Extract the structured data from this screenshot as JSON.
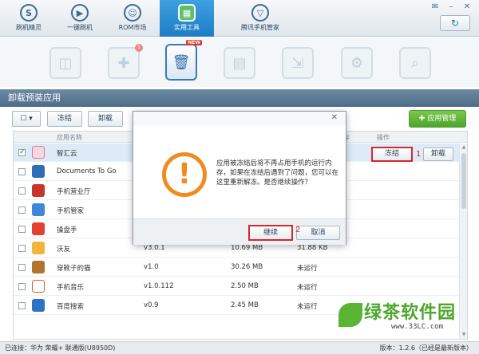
{
  "nav": {
    "items": [
      {
        "label": "刷机精灵",
        "icon": "S"
      },
      {
        "label": "一键刷机",
        "icon": "▶"
      },
      {
        "label": "ROM市场",
        "icon": "☺"
      },
      {
        "label": "实用工具",
        "icon": "▦"
      },
      {
        "label": "腾讯手机管家",
        "icon": "▽"
      }
    ],
    "window_controls": [
      "✉",
      "–",
      "✕"
    ],
    "refresh_glyph": "↻"
  },
  "tools": {
    "icons": [
      "bag-icon",
      "puzzle-icon",
      "trash-icon",
      "document-icon",
      "export-icon",
      "settings-icon",
      "search-icon"
    ],
    "badge_new": "NEW",
    "badge_count": "1"
  },
  "section": {
    "title": "卸载预装应用"
  },
  "toolbar": {
    "freeze_label": "冻结",
    "uninstall_label": "卸载",
    "app_manage_label": "应用管理"
  },
  "table": {
    "headers": {
      "name": "应用名称",
      "col5": "存",
      "action": "操作"
    },
    "rows": [
      {
        "name": "智汇云",
        "version": "",
        "size": "",
        "running": "",
        "checked": true
      },
      {
        "name": "Documents To Go",
        "version": "",
        "size": "",
        "running": "",
        "checked": false
      },
      {
        "name": "手机营业厅",
        "version": "",
        "size": "",
        "running": "",
        "checked": false
      },
      {
        "name": "手机管家",
        "version": "",
        "size": "",
        "running": "",
        "checked": false
      },
      {
        "name": "操盘手",
        "version": "",
        "size": "",
        "running": "",
        "checked": false
      },
      {
        "name": "沃友",
        "version": "v3.0.1",
        "size": "10.69 MB",
        "running": "31.88 KB",
        "checked": false
      },
      {
        "name": "穿靴子的猫",
        "version": "v1.0",
        "size": "30.26 MB",
        "running": "未运行",
        "checked": false
      },
      {
        "name": "手机音乐",
        "version": "v1.0.112",
        "size": "2.50 MB",
        "running": "未运行",
        "checked": false
      },
      {
        "name": "百度搜索",
        "version": "v0.9",
        "size": "2.45 MB",
        "running": "未运行",
        "checked": false
      }
    ],
    "row_actions": {
      "freeze": "冻结",
      "uninstall": "卸载"
    },
    "step1": "1"
  },
  "modal": {
    "message": "应用被冻结后将不再占用手机的运行内存，如果在冻结后遇到了问题，您可以在这里重新解冻。是否继续操作？",
    "continue_label": "继续",
    "cancel_label": "取消",
    "step2": "2",
    "warning_glyph": "!"
  },
  "status": {
    "connection": "已连接：华为 荣耀+ 联通版(U8950D)",
    "version": "版本：1.2.6（已经是最新版本）"
  },
  "watermark": {
    "text": "绿茶软件园",
    "url": "www.33LC.com"
  },
  "colors": {
    "accent_blue": "#1f7cc4",
    "highlight_red": "#d9262b",
    "green": "#4ea62b",
    "warning_orange": "#f08a23"
  }
}
